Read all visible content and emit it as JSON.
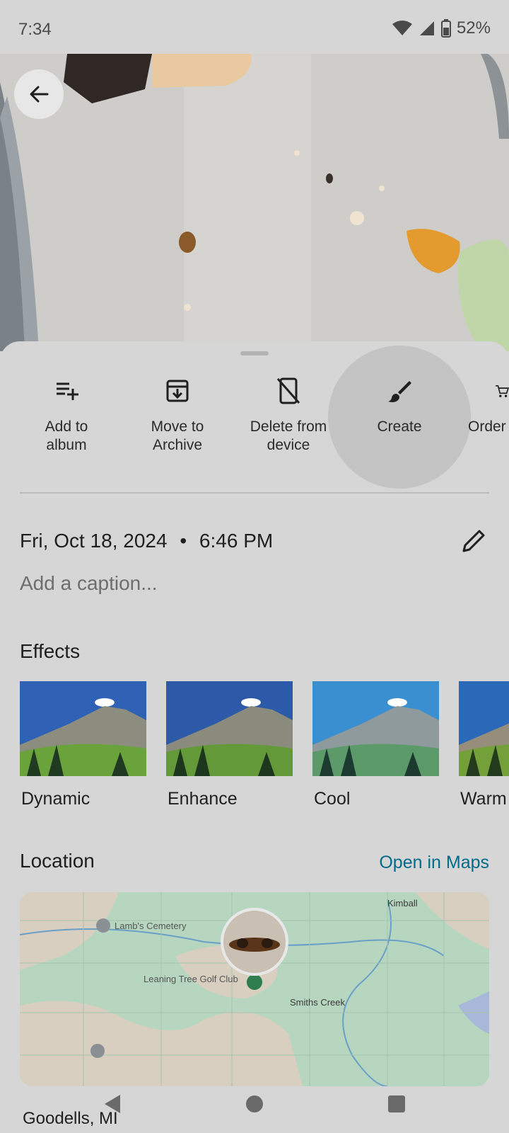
{
  "status": {
    "time": "7:34",
    "battery": "52%"
  },
  "photo": {
    "description_icon": "back-arrow-icon"
  },
  "actions": [
    {
      "label_line1": "Add to",
      "label_line2": "album",
      "icon": "playlist-add-icon"
    },
    {
      "label_line1": "Move to",
      "label_line2": "Archive",
      "icon": "archive-icon"
    },
    {
      "label_line1": "Delete from",
      "label_line2": "device",
      "icon": "phone-delete-icon"
    },
    {
      "label_line1": "Create",
      "label_line2": "",
      "icon": "brush-icon"
    },
    {
      "label_line1": "Order",
      "label_line2": "",
      "icon": "cart-icon"
    }
  ],
  "details": {
    "date": "Fri, Oct 18, 2024",
    "time": "6:46 PM",
    "caption_placeholder": "Add a caption..."
  },
  "effects": {
    "title": "Effects",
    "items": [
      {
        "label": "Dynamic"
      },
      {
        "label": "Enhance"
      },
      {
        "label": "Cool"
      },
      {
        "label": "Warm"
      }
    ]
  },
  "location": {
    "title": "Location",
    "open_maps": "Open in Maps",
    "map_labels": {
      "kimball": "Kimball",
      "cemetery": "Lamb's Cemetery",
      "golf": "Leaning Tree Golf Club",
      "smiths": "Smiths Creek"
    },
    "place_name": "Goodells, MI"
  },
  "colors": {
    "accent": "#006b8a",
    "sheet": "#d6d6d6",
    "map_green": "#b7d6c0"
  }
}
